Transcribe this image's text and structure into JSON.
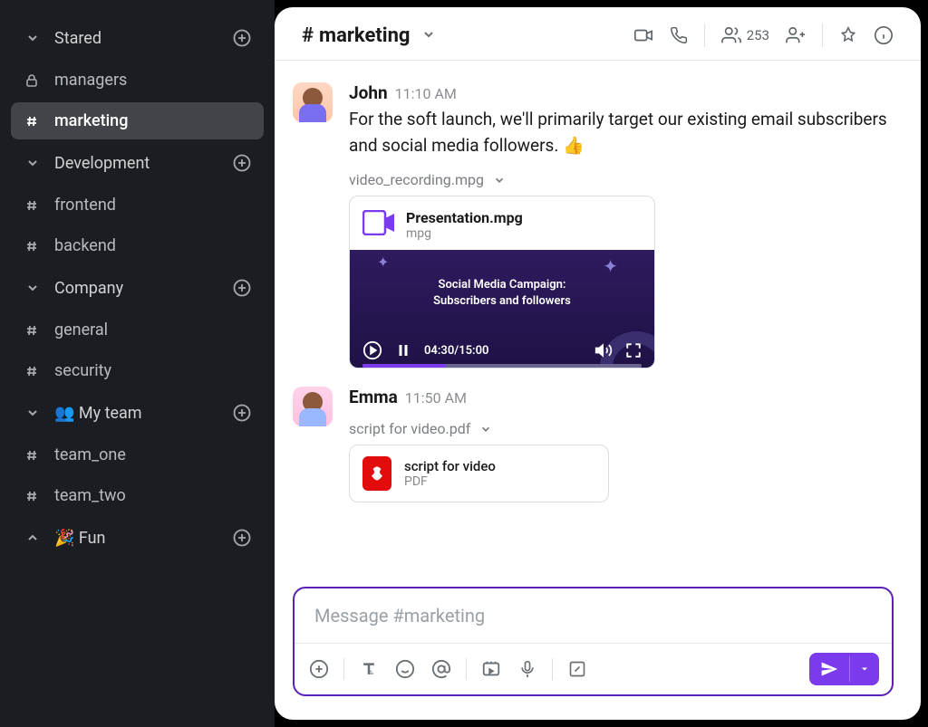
{
  "sidebar": {
    "sections": [
      {
        "title": "Stared",
        "collapsed": false,
        "items": [
          {
            "icon": "lock",
            "label": "managers",
            "active": false
          },
          {
            "icon": "hash",
            "label": "marketing",
            "active": true
          }
        ]
      },
      {
        "title": "Development",
        "collapsed": false,
        "items": [
          {
            "icon": "hash",
            "label": "frontend"
          },
          {
            "icon": "hash",
            "label": "backend"
          }
        ]
      },
      {
        "title": "Company",
        "collapsed": false,
        "items": [
          {
            "icon": "hash",
            "label": "general"
          },
          {
            "icon": "hash",
            "label": "security"
          }
        ]
      },
      {
        "title": "👥 My team",
        "collapsed": false,
        "items": [
          {
            "icon": "hash",
            "label": "team_one"
          },
          {
            "icon": "hash",
            "label": "team_two"
          }
        ]
      },
      {
        "title": "🎉 Fun",
        "collapsed": true,
        "items": []
      }
    ]
  },
  "header": {
    "channel_prefix": "#",
    "channel_name": "marketing",
    "member_count": "253"
  },
  "messages": [
    {
      "id": "m1",
      "author": "John",
      "time": "11:10 AM",
      "text": "For the soft launch, we'll primarily target our existing email subscribers and social media followers. 👍",
      "attachment_label": "video_recording.mpg",
      "attachment": {
        "type": "video",
        "title": "Presentation.mpg",
        "subtitle": "mpg",
        "preview_title_line1": "Social Media Campaign:",
        "preview_title_line2": "Subscribers and followers",
        "time_elapsed": "04:30",
        "time_total": "15:00"
      }
    },
    {
      "id": "m2",
      "author": "Emma",
      "time": "11:50 AM",
      "text": "",
      "attachment_label": "script for video.pdf",
      "attachment": {
        "type": "pdf",
        "title": "script for video",
        "subtitle": "PDF"
      }
    }
  ],
  "composer": {
    "placeholder": "Message #marketing"
  }
}
